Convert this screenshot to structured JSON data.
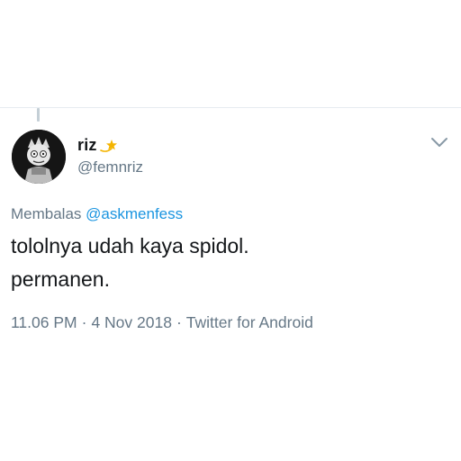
{
  "tweet": {
    "display_name": "riz",
    "name_emoji": "star-emoji",
    "handle": "@femnriz",
    "reply_prefix": "Membalas",
    "reply_mention": "@askmenfess",
    "text_lines": [
      "tololnya udah kaya spidol.",
      "permanen."
    ],
    "time": "11.06 PM",
    "date": "4 Nov 2018",
    "source": "Twitter for Android",
    "separator": "·"
  },
  "icons": {
    "avatar": "cartoon-avatar-image",
    "menu": "chevron-down-icon"
  },
  "colors": {
    "text_primary": "#14171a",
    "text_secondary": "#657786",
    "link": "#1b95e0",
    "divider": "#e6ecf0"
  }
}
